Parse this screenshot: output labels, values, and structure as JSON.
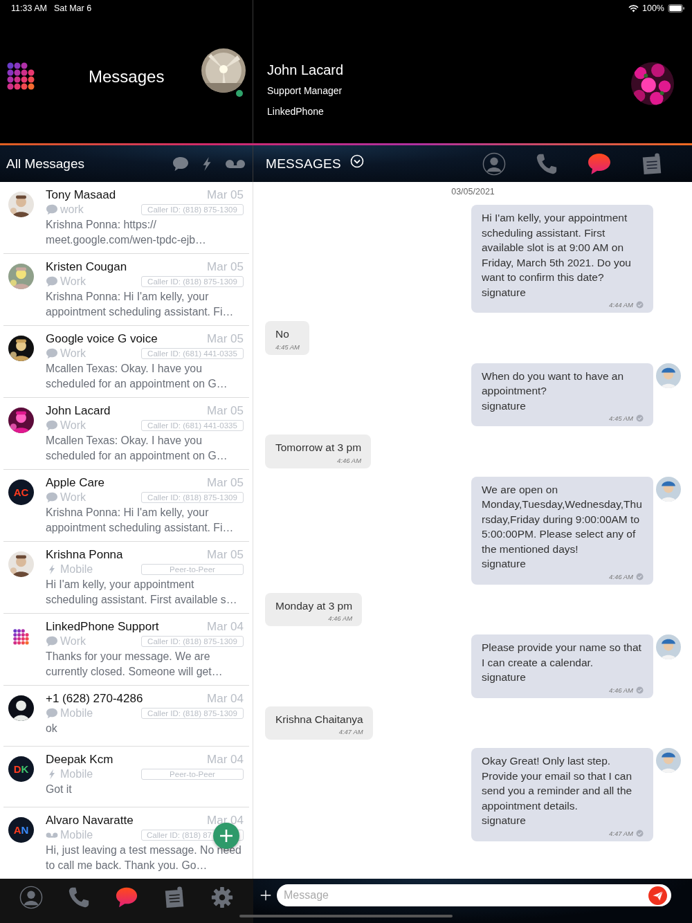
{
  "status_bar": {
    "time": "11:33 AM",
    "date": "Sat Mar 6",
    "battery": "100%"
  },
  "left_header": {
    "title": "Messages",
    "online": true
  },
  "contact_header": {
    "name": "John Lacard",
    "role": "Support Manager",
    "company": "LinkedPhone"
  },
  "list_toolbar": {
    "title": "All Messages",
    "filters": [
      {
        "kind": "chat"
      },
      {
        "kind": "bolt"
      },
      {
        "kind": "voicemail"
      }
    ]
  },
  "conversations": [
    {
      "name": "Tony Masaad",
      "date": "Mar 05",
      "channel": {
        "kind": "chat",
        "label": "work"
      },
      "tag": "Caller ID: (818) 875-1309",
      "preview": "Krishna Ponna: https:// meet.google.com/wen-tpdc-ejb…"
    },
    {
      "name": "Kristen Cougan",
      "date": "Mar 05",
      "channel": {
        "kind": "chat",
        "label": "Work"
      },
      "tag": "Caller ID: (818) 875-1309",
      "preview": "Krishna Ponna: Hi I'am kelly, your appointment scheduling assistant. Fi…"
    },
    {
      "name": "Google voice G voice",
      "date": "Mar 05",
      "channel": {
        "kind": "chat",
        "label": "Work"
      },
      "tag": "Caller ID: (681) 441-0335",
      "preview": "Mcallen Texas: Okay. I have you scheduled for an appointment on G…"
    },
    {
      "name": "John Lacard",
      "date": "Mar 05",
      "channel": {
        "kind": "chat",
        "label": "Work"
      },
      "tag": "Caller ID: (681) 441-0335",
      "preview": "Mcallen Texas: Okay. I have you scheduled for an appointment on G…"
    },
    {
      "avatar": {
        "kind": "initials",
        "letters": [
          {
            "char": "A",
            "color": "#ff3b1f"
          },
          {
            "char": "C",
            "color": "#ff3b1f"
          }
        ]
      },
      "name": "Apple Care",
      "date": "Mar 05",
      "channel": {
        "kind": "chat",
        "label": "Work"
      },
      "tag": "Caller ID: (818) 875-1309",
      "preview": "Krishna Ponna: Hi I'am kelly, your appointment scheduling assistant. Fi…"
    },
    {
      "name": "Krishna Ponna",
      "date": "Mar 05",
      "channel": {
        "kind": "bolt",
        "label": "Mobile"
      },
      "tag": "Peer-to-Peer",
      "preview": "Hi I'am kelly, your appointment scheduling assistant. First available s…"
    },
    {
      "avatar": {
        "kind": "logo"
      },
      "name": "LinkedPhone Support",
      "date": "Mar 04",
      "channel": {
        "kind": "chat",
        "label": "Work"
      },
      "tag": "Caller ID: (818) 875-1309",
      "preview": "Thanks for your message.  We are currently closed.  Someone will get…"
    },
    {
      "avatar": {
        "kind": "silhouette"
      },
      "name": "+1 (628) 270-4286",
      "date": "Mar 04",
      "channel": {
        "kind": "chat",
        "label": "Mobile"
      },
      "tag": "Caller ID: (818) 875-1309",
      "preview": "ok"
    },
    {
      "avatar": {
        "kind": "initials",
        "letters": [
          {
            "char": "D",
            "color": "#ff3b1f"
          },
          {
            "char": "K",
            "color": "#3ec46d"
          }
        ]
      },
      "name": "Deepak Kcm",
      "date": "Mar 04",
      "channel": {
        "kind": "bolt",
        "label": "Mobile"
      },
      "tag": "Peer-to-Peer",
      "preview": "Got it"
    },
    {
      "avatar": {
        "kind": "initials",
        "letters": [
          {
            "char": "A",
            "color": "#ff3b1f"
          },
          {
            "char": "N",
            "color": "#3a8bff"
          }
        ]
      },
      "name": "Alvaro Navaratte",
      "date": "Mar 04",
      "channel": {
        "kind": "voicemail",
        "label": "Mobile"
      },
      "tag": "Caller ID: (818) 87",
      "preview": "Hi, just leaving a test message. No need to call me back. Thank you. Go…"
    }
  ],
  "chat_toolbar": {
    "title": "MESSAGES",
    "tabs": [
      {
        "kind": "contact",
        "selected": false
      },
      {
        "kind": "phone",
        "selected": false
      },
      {
        "kind": "chat",
        "selected": true
      },
      {
        "kind": "notes",
        "selected": false
      }
    ]
  },
  "chat": {
    "date": "03/05/2021",
    "messages": [
      {
        "kind": "sent",
        "show_avatar": false,
        "text": "Hi I'am kelly, your appointment scheduling assistant. First available slot is at 9:00 AM on Friday, March 5th 2021. Do you want to confirm this date?",
        "signature": "signature",
        "time": "4:44 AM"
      },
      {
        "kind": "received",
        "text": "No",
        "time": "4:45 AM"
      },
      {
        "kind": "sent",
        "show_avatar": true,
        "text": "When do you want to have an appointment?",
        "signature": "signature",
        "time": "4:45 AM"
      },
      {
        "kind": "received",
        "text": "Tomorrow at 3 pm",
        "time": "4:46 AM"
      },
      {
        "kind": "sent",
        "show_avatar": true,
        "text": "We are open on Monday,Tuesday,Wednesday,Thursday,Friday during 9:00:00AM to 5:00:00PM. Please select any of the mentioned days!",
        "signature": "signature",
        "time": "4:46 AM"
      },
      {
        "kind": "received",
        "text": "Monday at 3 pm",
        "time": "4:46 AM"
      },
      {
        "kind": "sent",
        "show_avatar": true,
        "text": "Please provide your name so that I can create a calendar.",
        "signature": "signature",
        "time": "4:46 AM"
      },
      {
        "kind": "received",
        "text": "Krishna Chaitanya",
        "time": "4:47 AM"
      },
      {
        "kind": "sent",
        "show_avatar": true,
        "text": "Okay Great! Only last step. Provide your email so that I can send you a reminder and all the appointment details.",
        "signature": "signature",
        "time": "4:47 AM"
      }
    ]
  },
  "bottom_nav": [
    {
      "kind": "contact",
      "selected": false
    },
    {
      "kind": "phone",
      "selected": false
    },
    {
      "kind": "chat",
      "selected": true
    },
    {
      "kind": "notes",
      "selected": false
    },
    {
      "kind": "settings",
      "selected": false
    }
  ],
  "composer": {
    "placeholder": "Message"
  }
}
